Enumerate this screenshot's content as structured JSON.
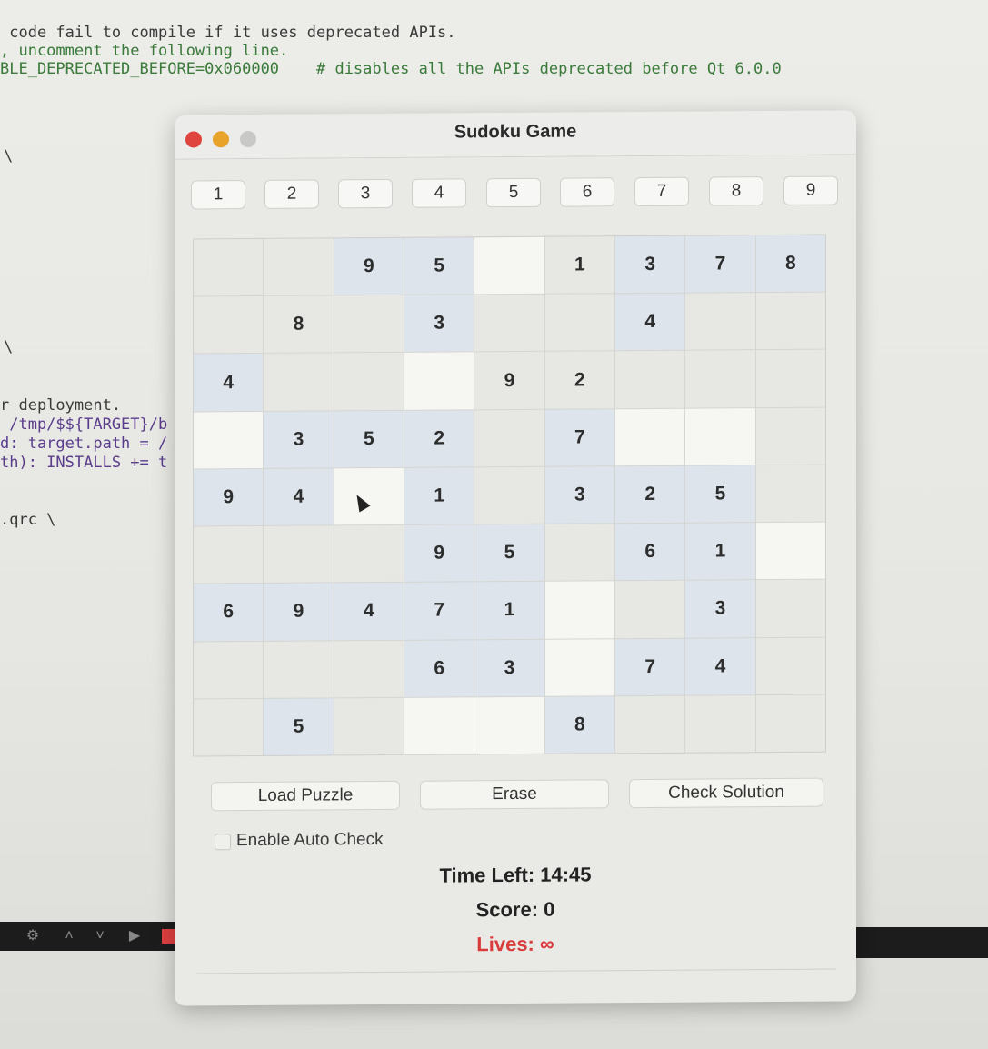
{
  "background": {
    "code_lines": [
      " code fail to compile if it uses deprecated APIs.",
      ", uncomment the following line.",
      "BLE_DEPRECATED_BEFORE=0x060000    # disables all the APIs deprecated before Qt 6.0.0"
    ],
    "backslash": "\\",
    "deploy_lines": [
      "r deployment.",
      " /tmp/$${TARGET}/b",
      "d: target.path = /",
      "th): INSTALLS += t"
    ],
    "qrc_line": ".qrc \\"
  },
  "window": {
    "title": "Sudoku Game",
    "number_buttons": [
      "1",
      "2",
      "3",
      "4",
      "5",
      "6",
      "7",
      "8",
      "9"
    ],
    "grid": [
      [
        "",
        "",
        "9",
        "5",
        "",
        "1",
        "3",
        "7",
        "8"
      ],
      [
        "",
        "8",
        "",
        "3",
        "",
        "",
        "4",
        "",
        ""
      ],
      [
        "4",
        "",
        "",
        "",
        "9",
        "2",
        "",
        "",
        ""
      ],
      [
        "",
        "3",
        "5",
        "2",
        "",
        "7",
        "",
        "",
        ""
      ],
      [
        "9",
        "4",
        "",
        "1",
        "",
        "3",
        "2",
        "5",
        ""
      ],
      [
        "",
        "",
        "",
        "9",
        "5",
        "",
        "6",
        "1",
        ""
      ],
      [
        "6",
        "9",
        "4",
        "7",
        "1",
        "",
        "",
        "3",
        ""
      ],
      [
        "",
        "",
        "",
        "6",
        "3",
        "",
        "7",
        "4",
        ""
      ],
      [
        "",
        "5",
        "",
        "",
        "",
        "8",
        "",
        "",
        ""
      ]
    ],
    "buttons": {
      "load": "Load Puzzle",
      "erase": "Erase",
      "check": "Check Solution"
    },
    "auto_check_label": "Enable Auto Check",
    "time_left": "Time Left: 14:45",
    "score": "Score: 0",
    "lives": "Lives: ∞"
  }
}
